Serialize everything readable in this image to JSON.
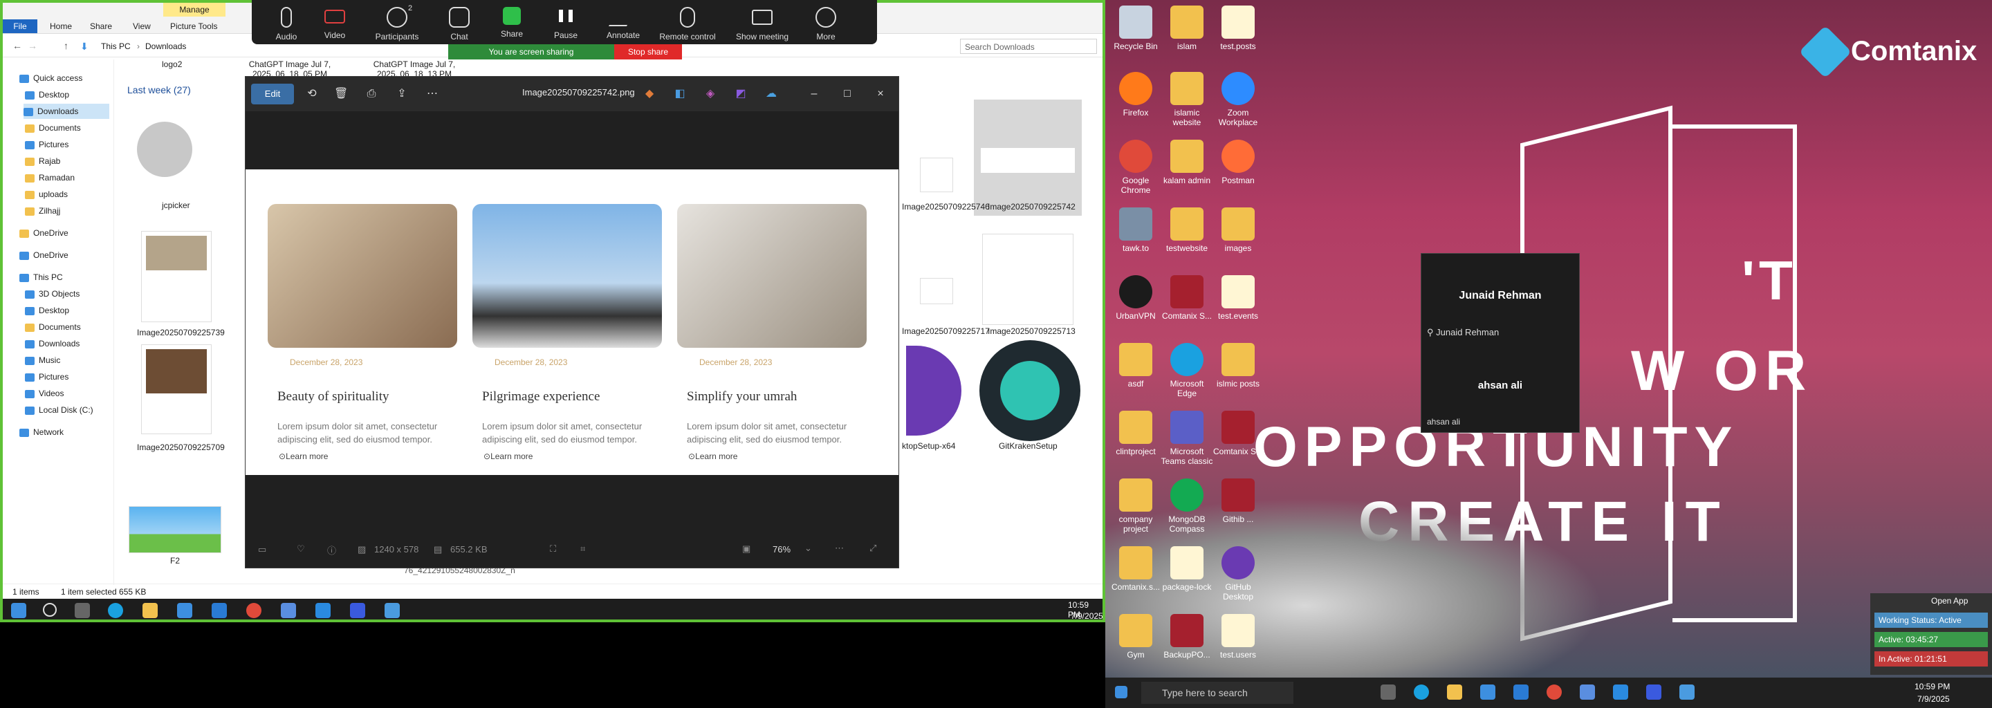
{
  "explorer": {
    "ribbon_tabs": [
      "File",
      "Home",
      "Share",
      "View",
      "Picture Tools"
    ],
    "manage_label": "Manage",
    "breadcrumb": [
      "This PC",
      "Downloads"
    ],
    "search_placeholder": "Search Downloads",
    "nav": [
      "Quick access",
      "Desktop",
      "Downloads",
      "Documents",
      "Pictures",
      "Rajab",
      "Ramadan",
      "uploads",
      "Zilhajj",
      "OneDrive",
      "OneDrive",
      "This PC",
      "3D Objects",
      "Desktop",
      "Documents",
      "Downloads",
      "Music",
      "Pictures",
      "Videos",
      "Local Disk (C:)",
      "Network"
    ],
    "group_header": "Last week (27)",
    "top_labels": [
      "logo2",
      "ChatGPT Image Jul 7, 2025, 06_18_05 PM",
      "ChatGPT Image Jul 7, 2025, 06_18_13 PM"
    ],
    "files": [
      "jcpicker",
      "Image20250709225739",
      "Image20250709225709",
      "F2",
      "Image20250709225742",
      "Image20250709225746",
      "Image20250709225717",
      "Image20250709225713",
      "GitKrakenSetup",
      "ktopSetup-x64",
      "76_421291055248002830Z_n"
    ],
    "status_items": "1 items",
    "status_selected": "1 item selected  655 KB"
  },
  "zoom": {
    "buttons": [
      "Audio",
      "Video",
      "Participants",
      "Chat",
      "Share",
      "Pause",
      "Annotate",
      "Remote control",
      "Show meeting",
      "More"
    ],
    "participant_count": "2",
    "sharing_text": "You are screen sharing",
    "stop_share": "Stop share"
  },
  "viewer": {
    "edit": "Edit",
    "title": "Image20250709225742.png",
    "cards": [
      {
        "date": "December 28, 2023",
        "title": "Beauty of spirituality",
        "text": "Lorem ipsum dolor sit amet, consectetur adipiscing elit, sed do eiusmod tempor.",
        "more": "Learn more"
      },
      {
        "date": "December 28, 2023",
        "title": "Pilgrimage experience",
        "text": "Lorem ipsum dolor sit amet, consectetur adipiscing elit, sed do eiusmod tempor.",
        "more": "Learn more"
      },
      {
        "date": "December 28, 2023",
        "title": "Simplify your umrah",
        "text": "Lorem ipsum dolor sit amet, consectetur adipiscing elit, sed do eiusmod tempor.",
        "more": "Learn more"
      }
    ],
    "dimensions": "1240 x 578",
    "size": "655.2 KB",
    "zoom": "76%"
  },
  "taskbar_left": {
    "time": "10:59 PM",
    "date": "7/9/2025"
  },
  "desktop": {
    "brand": "Comtanix",
    "wall_text": [
      "'T",
      "W  OR",
      "OPPORTUNITY",
      "CREATE IT"
    ],
    "icons": [
      "Recycle Bin",
      "islam",
      "test.posts",
      "Firefox",
      "islamic website",
      "Zoom Workplace",
      "Google Chrome",
      "kalam admin",
      "Postman",
      "tawk.to",
      "testwebsite",
      "images",
      "UrbanVPN",
      "Comtanix S...",
      "test.events",
      "asdf",
      "Microsoft Edge",
      "islmic posts",
      "clintproject",
      "Microsoft Teams classic",
      "Comtanix S...",
      "company project",
      "MongoDB Compass",
      "Githib ...",
      "Comtanix.s...",
      "package-lock",
      "GitHub Desktop",
      "Gym",
      "BackupPO...",
      "test.users"
    ],
    "meeting": {
      "host": "Junaid Rehman",
      "host_tag": "Junaid Rehman",
      "guest": "ahsan ali",
      "guest_tag": "ahsan ali"
    },
    "activity": {
      "open_app": "Open App",
      "working": "Working Status: Active",
      "active": "Active: 03:45:27",
      "inactive": "In Active: 01:21:51"
    },
    "search": "Type here to search",
    "time": "10:59 PM",
    "date": "7/9/2025"
  }
}
